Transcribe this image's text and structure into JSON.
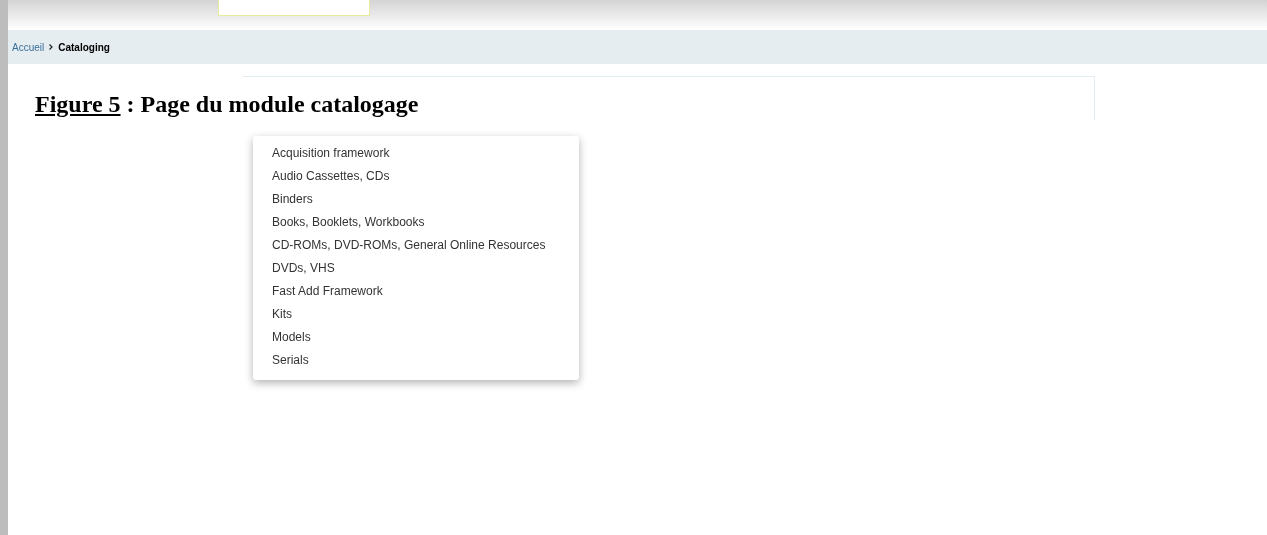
{
  "breadcrumb": [
    {
      "label": "Accueil",
      "kind": "link"
    },
    {
      "label": "Cataloging",
      "kind": "current"
    }
  ],
  "caption": {
    "label": "Figure 5",
    "text": " : Page du module catalogage"
  },
  "menu": {
    "items": [
      {
        "label": "Acquisition framework"
      },
      {
        "label": "Audio Cassettes, CDs"
      },
      {
        "label": "Binders"
      },
      {
        "label": "Books, Booklets, Workbooks"
      },
      {
        "label": "CD-ROMs, DVD-ROMs, General Online Resources"
      },
      {
        "label": "DVDs, VHS"
      },
      {
        "label": "Fast Add Framework"
      },
      {
        "label": "Kits"
      },
      {
        "label": "Models"
      },
      {
        "label": "Serials"
      }
    ]
  }
}
